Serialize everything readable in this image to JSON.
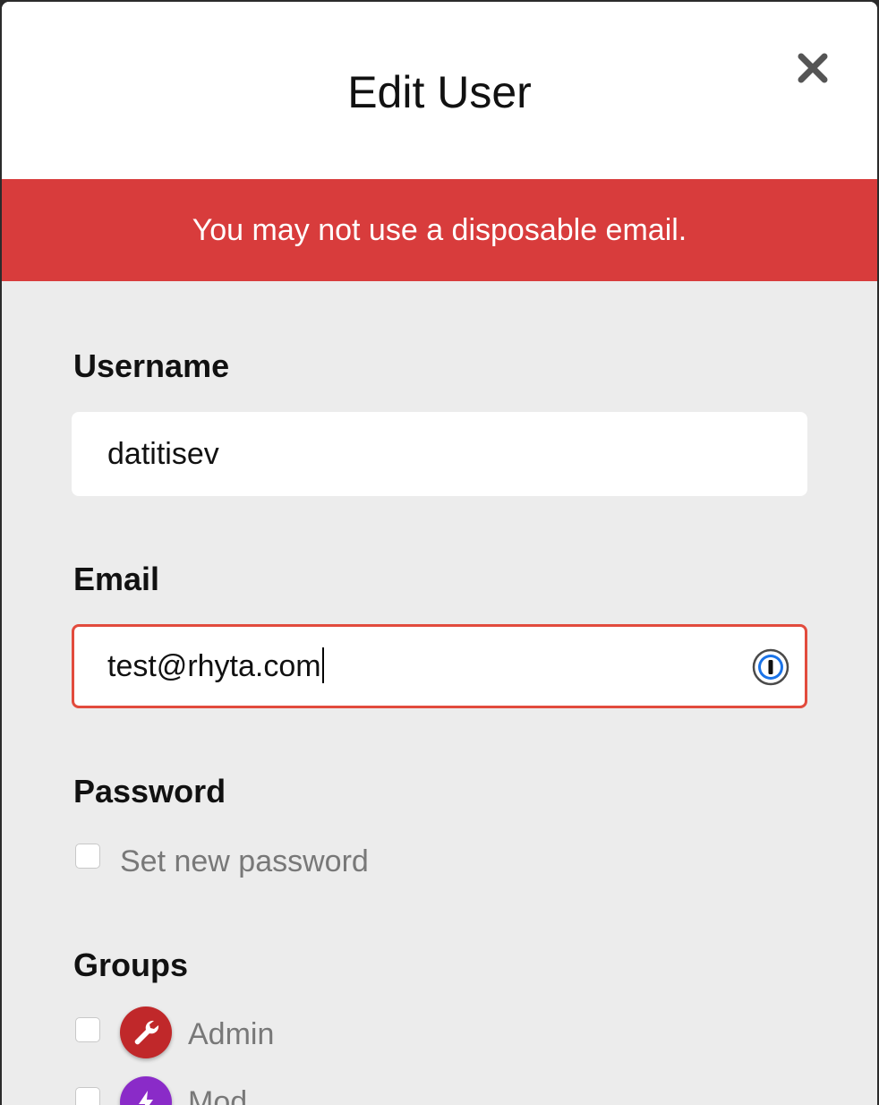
{
  "dialog": {
    "title": "Edit User",
    "close_icon": "close-icon"
  },
  "alert": {
    "message": "You may not use a disposable email.",
    "color": "#d83c3c"
  },
  "form": {
    "username": {
      "label": "Username",
      "value": "datitisev"
    },
    "email": {
      "label": "Email",
      "value": "test@rhyta.com",
      "border_color": "#e24b3d",
      "icon": "password-manager-icon"
    },
    "password": {
      "label": "Password",
      "checkbox_label": "Set new password",
      "checked": false
    },
    "groups": {
      "label": "Groups",
      "items": [
        {
          "name": "Admin",
          "icon": "wrench-icon",
          "color": "#c0282a",
          "checked": false
        },
        {
          "name": "Mod",
          "icon": "bolt-icon",
          "color": "#8a2bc8",
          "checked": false
        }
      ]
    }
  }
}
